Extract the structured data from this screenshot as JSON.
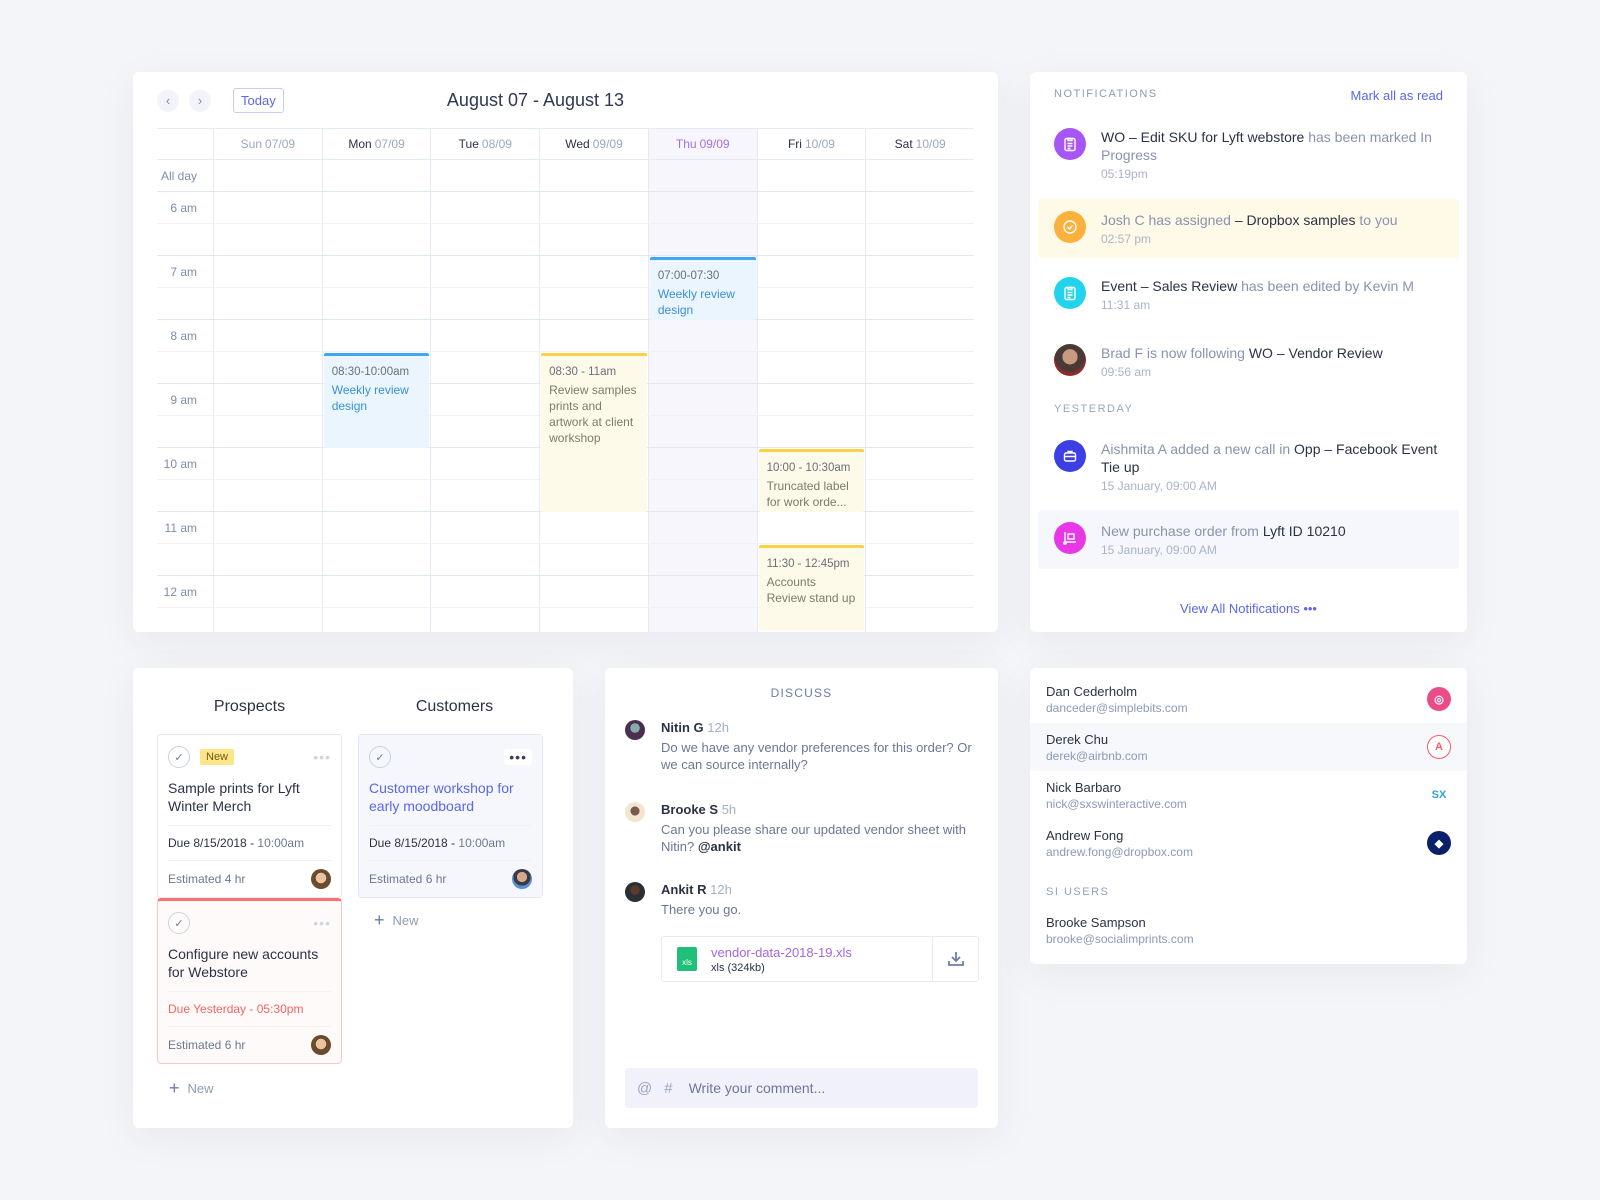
{
  "calendar": {
    "title": "August 07 - August 13",
    "today_label": "Today",
    "prev_icon": "‹",
    "next_icon": "›",
    "all_day_label": "All day",
    "days": [
      {
        "name": "Sun",
        "date": "07/09",
        "muted": true
      },
      {
        "name": "Mon",
        "date": "07/09"
      },
      {
        "name": "Tue",
        "date": "08/09"
      },
      {
        "name": "Wed",
        "date": "09/09"
      },
      {
        "name": "Thu",
        "date": "09/09",
        "today": true
      },
      {
        "name": "Fri",
        "date": "10/09"
      },
      {
        "name": "Sat",
        "date": "10/09"
      }
    ],
    "hours": [
      "6 am",
      "7 am",
      "8 am",
      "9 am",
      "10 am",
      "11 am",
      "12 am"
    ],
    "events": [
      {
        "day": 4,
        "start": 7.0,
        "end": 8.0,
        "time": "07:00-07:30",
        "name": "Weekly review design",
        "color": "blue"
      },
      {
        "day": 1,
        "start": 8.5,
        "end": 10.0,
        "time": "08:30-10:00am",
        "name": "Weekly review design",
        "color": "blue"
      },
      {
        "day": 3,
        "start": 8.5,
        "end": 11.0,
        "time": "08:30 - 11am",
        "name": "Review samples prints and artwork at client workshop",
        "color": "yellow"
      },
      {
        "day": 5,
        "start": 10.0,
        "end": 11.0,
        "time": "10:00 - 10:30am",
        "name": "Truncated label for work orde...",
        "color": "yellow"
      },
      {
        "day": 5,
        "start": 11.5,
        "end": 12.85,
        "time": "11:30 - 12:45pm",
        "name": "Accounts Review stand up",
        "color": "yellow"
      }
    ]
  },
  "notifications": {
    "title": "NOTIFICATIONS",
    "mark_all": "Mark all as read",
    "yesterday_label": "YESTERDAY",
    "view_all": "View All Notifications •••",
    "items": [
      {
        "icon": "clipboard-icon",
        "color": "#a855f7",
        "parts": [
          [
            "b",
            "WO – Edit SKU for Lyft webstore"
          ],
          [
            "t",
            " has been marked In Progress"
          ]
        ],
        "time": "05:19pm"
      },
      {
        "icon": "check-circle-icon",
        "color": "#fbb13c",
        "parts": [
          [
            "t",
            "Josh C has assigned "
          ],
          [
            "b",
            "– Dropbox samples"
          ],
          [
            "t",
            " to you"
          ]
        ],
        "time": "02:57 pm",
        "highlight": "yellow"
      },
      {
        "icon": "clipboard-icon",
        "color": "#22d3ee",
        "parts": [
          [
            "b",
            "Event – Sales Review"
          ],
          [
            "t",
            " has been edited by Kevin M"
          ]
        ],
        "time": "11:31 am"
      },
      {
        "icon": "user-avatar",
        "color": "#6b5a52",
        "parts": [
          [
            "t",
            "Brad F is now following "
          ],
          [
            "b",
            "WO – Vendor Review"
          ]
        ],
        "time": "09:56 am"
      },
      {
        "icon": "briefcase-icon",
        "color": "#3b3fe4",
        "parts": [
          [
            "t",
            "Aishmita A added a new call in "
          ],
          [
            "b",
            "Opp – Facebook Event Tie up"
          ]
        ],
        "time": "15 January, 09:00 AM"
      },
      {
        "icon": "cart-icon",
        "color": "#e838e6",
        "parts": [
          [
            "t",
            "New purchase order from "
          ],
          [
            "b",
            "Lyft ID 10210"
          ]
        ],
        "time": "15 January, 09:00 AM",
        "highlight": "blue"
      }
    ]
  },
  "board": {
    "columns": [
      "Prospects",
      "Customers"
    ],
    "new_label": "New",
    "cards": [
      {
        "badge": "New",
        "title": "Sample prints for Lyft Winter Merch",
        "due_prefix": "Due 8/15/2018 - ",
        "due_time": "10:00am",
        "estimate": "Estimated 4 hr"
      },
      {
        "title": "Configure new accounts for Webstore",
        "due_prefix": "Due Yesterday - ",
        "due_time": "05:30pm",
        "estimate": "Estimated 6 hr",
        "overdue": true
      },
      {
        "title": "Customer workshop for early moodboard",
        "due_prefix": "Due 8/15/2018 - ",
        "due_time": "10:00am",
        "estimate": "Estimated 6 hr",
        "active": true
      }
    ]
  },
  "discuss": {
    "title": "DISCUSS",
    "messages": [
      {
        "name": "Nitin G",
        "ago": "12h",
        "text": "Do we have any vendor preferences for this order? Or we can source internally?"
      },
      {
        "name": "Brooke S",
        "ago": "5h",
        "text": "Can you please share our updated vendor sheet with Nitin?",
        "mention": "@ankit"
      },
      {
        "name": "Ankit R",
        "ago": "12h",
        "text": "There you go."
      }
    ],
    "file": {
      "name": "vendor-data-2018-19.xls",
      "meta": "xls (324kb)",
      "type": "xls"
    },
    "comment_placeholder": "Write your comment...",
    "at_icon": "@",
    "hash_icon": "#"
  },
  "contacts": {
    "items": [
      {
        "name": "Dan Cederholm",
        "email": "danceder@simplebits.com",
        "logo": "dribbble-logo"
      },
      {
        "name": "Derek Chu",
        "email": "derek@airbnb.com",
        "logo": "airbnb-logo",
        "highlight": true
      },
      {
        "name": "Nick Barbaro",
        "email": "nick@sxswinteractive.com",
        "logo": "sxsw-logo"
      },
      {
        "name": "Andrew Fong",
        "email": "andrew.fong@dropbox.com",
        "logo": "dropbox-logo"
      }
    ],
    "section_label": "SI USERS",
    "si_users": [
      {
        "name": "Brooke Sampson",
        "email": "brooke@socialimprints.com"
      }
    ]
  }
}
